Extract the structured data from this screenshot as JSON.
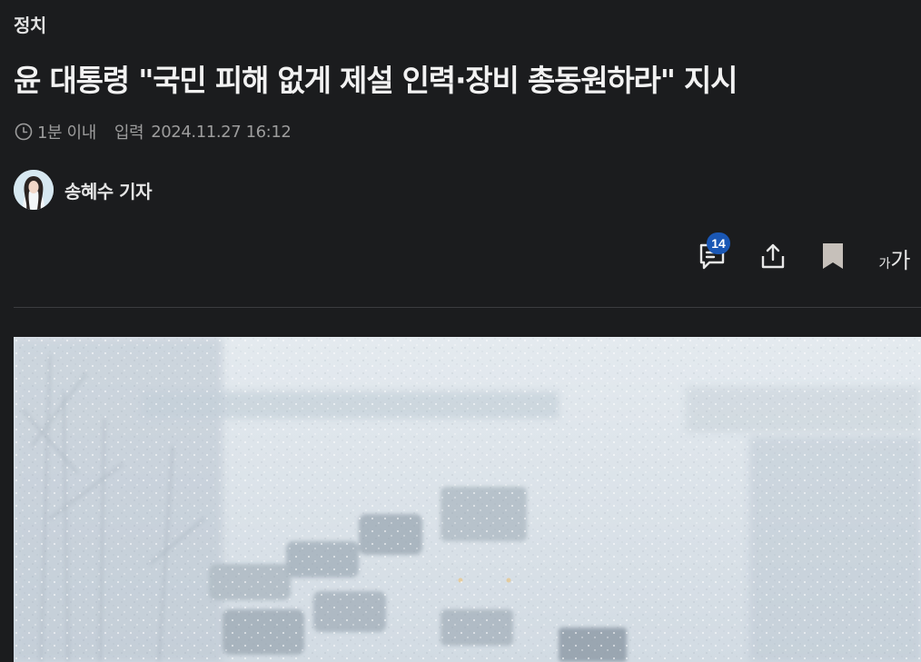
{
  "article": {
    "category": "정치",
    "headline": "윤 대통령 \"국민 피해 없게 제설 인력·장비 총동원하라\" 지시",
    "read_time": "1분 이내",
    "posted_label": "입력",
    "posted_time": "2024.11.27 16:12",
    "reporter": "송혜수 기자"
  },
  "toolbar": {
    "comment_count": "14",
    "font_size_small": "가",
    "font_size_large": "가",
    "icons": [
      "comment-icon",
      "share-icon",
      "bookmark-icon",
      "font-size-icon"
    ]
  },
  "colors": {
    "background": "#1b1c1e",
    "badge": "#1a57b5",
    "divider": "#3c3d40",
    "meta_text": "#9c9c9c"
  }
}
